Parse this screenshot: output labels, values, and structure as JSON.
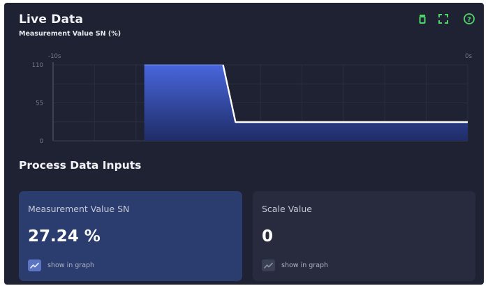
{
  "header": {
    "title": "Live Data",
    "subtitle": "Measurement Value SN (%)"
  },
  "toolbar": {
    "icons": [
      "trash-icon",
      "fullscreen-icon",
      "help-icon"
    ],
    "accent_color": "#4fd46a"
  },
  "chart_data": {
    "type": "area",
    "x_tick_labels": [
      "-10s",
      "0s"
    ],
    "xlim": [
      -10,
      0
    ],
    "y_ticks": [
      0,
      55,
      110
    ],
    "ylim": [
      0,
      110
    ],
    "grid": true,
    "series": [
      {
        "x": [
          -7.8,
          -5.9,
          -5.6,
          0
        ],
        "y": [
          110,
          110,
          27.24,
          27.24
        ],
        "color": "#3f5fd1"
      }
    ]
  },
  "section": {
    "title": "Process Data Inputs"
  },
  "cards": [
    {
      "label": "Measurement Value SN",
      "value": "27.24 %",
      "graph_label": "show in graph",
      "in_graph": true
    },
    {
      "label": "Scale Value",
      "value": "0",
      "graph_label": "show in graph",
      "in_graph": false
    }
  ]
}
